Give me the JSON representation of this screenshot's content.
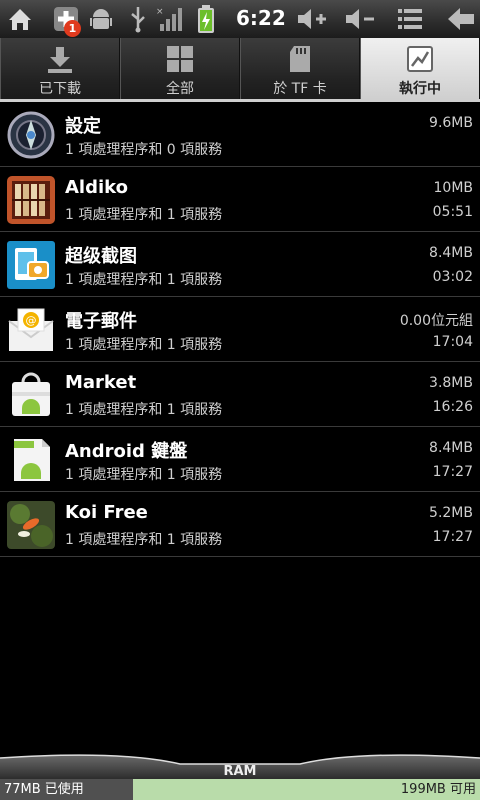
{
  "status_bar": {
    "time": "6:22",
    "notification_count": "1",
    "icons": [
      "home-icon",
      "add-notification-icon",
      "android-debug-icon",
      "usb-icon",
      "signal-icon",
      "battery-charging-icon",
      "volume-up-icon",
      "volume-down-icon",
      "menu-icon",
      "back-icon"
    ]
  },
  "tabs": [
    {
      "label": "已下載",
      "icon": "download-icon",
      "active": false
    },
    {
      "label": "全部",
      "icon": "grid-icon",
      "active": false
    },
    {
      "label": "於 TF 卡",
      "icon": "sdcard-icon",
      "active": false
    },
    {
      "label": "執行中",
      "icon": "running-icon",
      "active": true
    }
  ],
  "apps": [
    {
      "name": "設定",
      "sub": "1 項處理程序和 0 項服務",
      "size": "9.6MB",
      "time": "",
      "icon": "settings-app-icon"
    },
    {
      "name": "Aldiko",
      "sub": "1 項處理程序和 1 項服務",
      "size": "10MB",
      "time": "05:51",
      "icon": "aldiko-app-icon"
    },
    {
      "name": "超级截图",
      "sub": "1 項處理程序和 1 項服務",
      "size": "8.4MB",
      "time": "03:02",
      "icon": "screenshot-app-icon"
    },
    {
      "name": "電子郵件",
      "sub": "1 項處理程序和 1 項服務",
      "size": "0.00位元組",
      "time": "17:04",
      "icon": "email-app-icon"
    },
    {
      "name": "Market",
      "sub": "1 項處理程序和 1 項服務",
      "size": "3.8MB",
      "time": "16:26",
      "icon": "market-app-icon"
    },
    {
      "name": "Android 鍵盤",
      "sub": "1 項處理程序和 1 項服務",
      "size": "8.4MB",
      "time": "17:27",
      "icon": "keyboard-app-icon"
    },
    {
      "name": "Koi Free",
      "sub": "1 項處理程序和 1 項服務",
      "size": "5.2MB",
      "time": "17:27",
      "icon": "koi-app-icon"
    }
  ],
  "ram": {
    "label": "RAM",
    "used": "77MB 已使用",
    "free": "199MB 可用",
    "used_color": "#505050",
    "free_color": "#b9dcaa"
  }
}
